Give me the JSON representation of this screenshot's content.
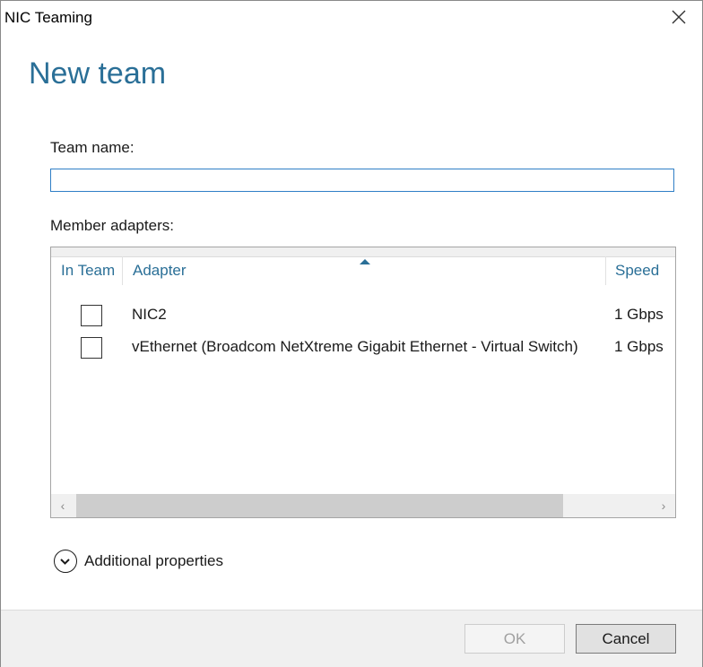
{
  "window": {
    "title": "NIC Teaming"
  },
  "page": {
    "heading": "New team"
  },
  "team_name": {
    "label": "Team name:",
    "value": "",
    "placeholder": ""
  },
  "member_adapters": {
    "label": "Member adapters:",
    "columns": {
      "in_team": "In Team",
      "adapter": "Adapter",
      "speed": "Speed"
    },
    "sort_column": "Adapter",
    "rows": [
      {
        "checked": false,
        "adapter": "NIC2",
        "speed": "1 Gbps"
      },
      {
        "checked": false,
        "adapter": "vEthernet (Broadcom NetXtreme Gigabit Ethernet - Virtual Switch)",
        "speed": "1 Gbps"
      }
    ]
  },
  "additional_properties": {
    "label": "Additional properties",
    "icon": "chevron-down-circle-icon"
  },
  "buttons": {
    "ok": "OK",
    "cancel": "Cancel",
    "ok_enabled": false
  },
  "colors": {
    "accent": "#2a6f97",
    "focus_border": "#2f7fc6"
  }
}
